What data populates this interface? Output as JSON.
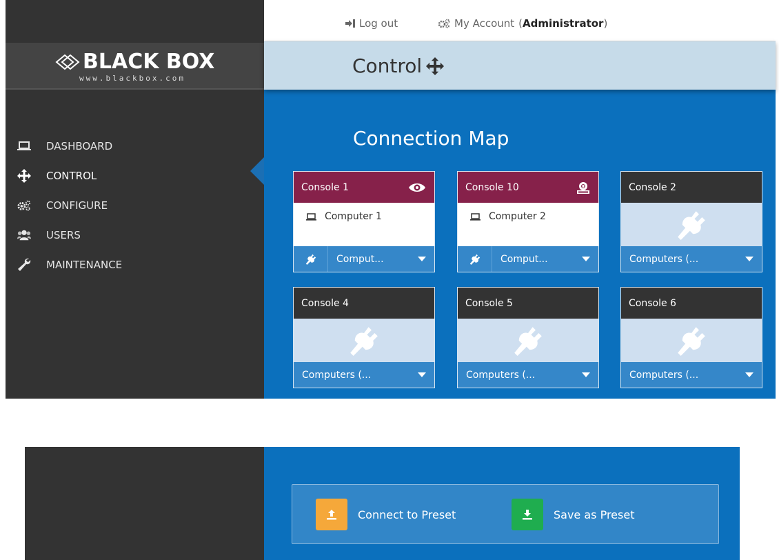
{
  "brand": {
    "name": "BLACK BOX",
    "url": "www.blackbox.com"
  },
  "header": {
    "logout_label": "Log out",
    "account_label": "My Account",
    "account_role": "Administrator"
  },
  "page": {
    "title": "Control",
    "section_title": "Connection Map"
  },
  "sidebar": {
    "items": [
      {
        "label": "DASHBOARD",
        "icon": "laptop-icon",
        "active": false
      },
      {
        "label": "CONTROL",
        "icon": "move-arrows-icon",
        "active": true
      },
      {
        "label": "CONFIGURE",
        "icon": "gears-icon",
        "active": false
      },
      {
        "label": "USERS",
        "icon": "users-icon",
        "active": false
      },
      {
        "label": "MAINTENANCE",
        "icon": "wrench-icon",
        "active": false
      }
    ]
  },
  "consoles": [
    {
      "name": "Console 1",
      "status_icon": "eye-icon",
      "connected": true,
      "computer": "Computer 1",
      "select_value": "Comput..."
    },
    {
      "name": "Console 10",
      "status_icon": "private-lock-icon",
      "connected": true,
      "computer": "Computer 2",
      "select_value": "Comput..."
    },
    {
      "name": "Console 2",
      "connected": false,
      "select_value": "Computers (..."
    },
    {
      "name": "Console 4",
      "connected": false,
      "select_value": "Computers (..."
    },
    {
      "name": "Console 5",
      "connected": false,
      "select_value": "Computers (..."
    },
    {
      "name": "Console 6",
      "connected": false,
      "select_value": "Computers (..."
    }
  ],
  "presets": {
    "connect_label": "Connect to Preset",
    "save_label": "Save as Preset"
  },
  "colors": {
    "sidebar_bg": "#333333",
    "main_bg": "#0b70bd",
    "titlebar_bg": "#c6dbe9",
    "selected_console": "#86214a",
    "card_footer": "#3587c9",
    "connect_preset": "#f5a83a",
    "save_preset": "#1fad4f"
  }
}
